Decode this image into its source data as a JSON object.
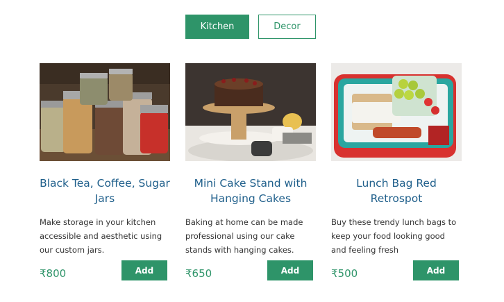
{
  "tabs": [
    {
      "label": "Kitchen",
      "active": true
    },
    {
      "label": "Decor",
      "active": false
    }
  ],
  "products": [
    {
      "title": "Black Tea, Coffee, Sugar Jars",
      "description": "Make storage in your kitchen accessible and aesthetic using our custom jars.",
      "price": "₹800",
      "button_label": "Add",
      "image": "spice-jars-photo"
    },
    {
      "title": "Mini Cake Stand with Hanging Cakes",
      "description": "Baking at home can be made professional using our cake stands with hanging cakes.",
      "price": "₹650",
      "button_label": "Add",
      "image": "chocolate-cake-stand-photo"
    },
    {
      "title": "Lunch Bag Red Retrospot",
      "description": "Buy these trendy lunch bags to keep your food looking good and feeling fresh",
      "price": "₹500",
      "button_label": "Add",
      "image": "red-lunch-bag-photo"
    }
  ],
  "colors": {
    "accent": "#2e9469",
    "title": "#1f5f8b"
  }
}
